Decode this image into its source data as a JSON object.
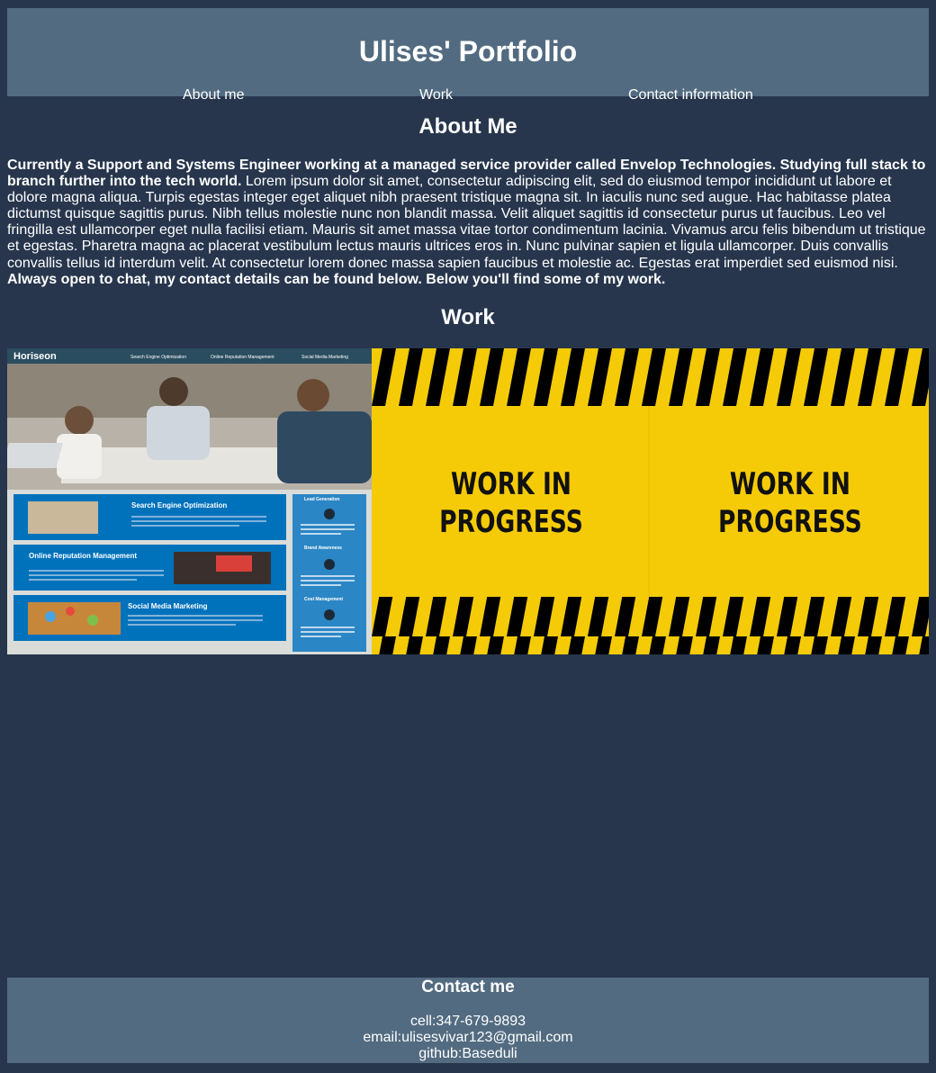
{
  "header": {
    "title": "Ulises' Portfolio",
    "nav": [
      "About me",
      "Work",
      "Contact information"
    ]
  },
  "about": {
    "heading": "About Me",
    "intro_bold": "Currently a Support and Systems Engineer working at a managed service provider called Envelop Technologies. Studying full stack to branch further into the tech world.",
    "body": "Lorem ipsum dolor sit amet, consectetur adipiscing elit, sed do eiusmod tempor incididunt ut labore et dolore magna aliqua. Turpis egestas integer eget aliquet nibh praesent tristique magna sit. In iaculis nunc sed augue. Hac habitasse platea dictumst quisque sagittis purus. Nibh tellus molestie nunc non blandit massa. Velit aliquet sagittis id consectetur purus ut faucibus. Leo vel fringilla est ullamcorper eget nulla facilisi etiam. Mauris sit amet massa vitae tortor condimentum lacinia. Vivamus arcu felis bibendum ut tristique et egestas. Pharetra magna ac placerat vestibulum lectus mauris ultrices eros in. Nunc pulvinar sapien et ligula ullamcorper. Duis convallis convallis tellus id interdum velit. At consectetur lorem donec massa sapien faucibus et molestie ac. Egestas erat imperdiet sed euismod nisi.",
    "outro_bold": "Always open to chat, my contact details can be found below. Below you'll find some of my work."
  },
  "work": {
    "heading": "Work",
    "project1": {
      "brand": "Horiseon",
      "nav": [
        "Search Engine Optimization",
        "Online Reputation Management",
        "Social Media Marketing"
      ],
      "cards": [
        "Search Engine Optimization",
        "Online Reputation Management",
        "Social Media Marketing"
      ],
      "side": [
        "Lead Generation",
        "Brand Awareness",
        "Cost Management"
      ]
    },
    "project2": {
      "banner_line1": "WORK IN",
      "banner_line2": "PROGRESS"
    }
  },
  "contact": {
    "heading": "Contact me",
    "cell": "cell:347-679-9893",
    "email": "email:ulisesvivar123@gmail.com",
    "github": "github:Baseduli"
  },
  "colors": {
    "background": "#27364d",
    "header": "#526b80",
    "caution_yellow": "#f4cb06",
    "horiseon_blue": "#0072bc"
  }
}
